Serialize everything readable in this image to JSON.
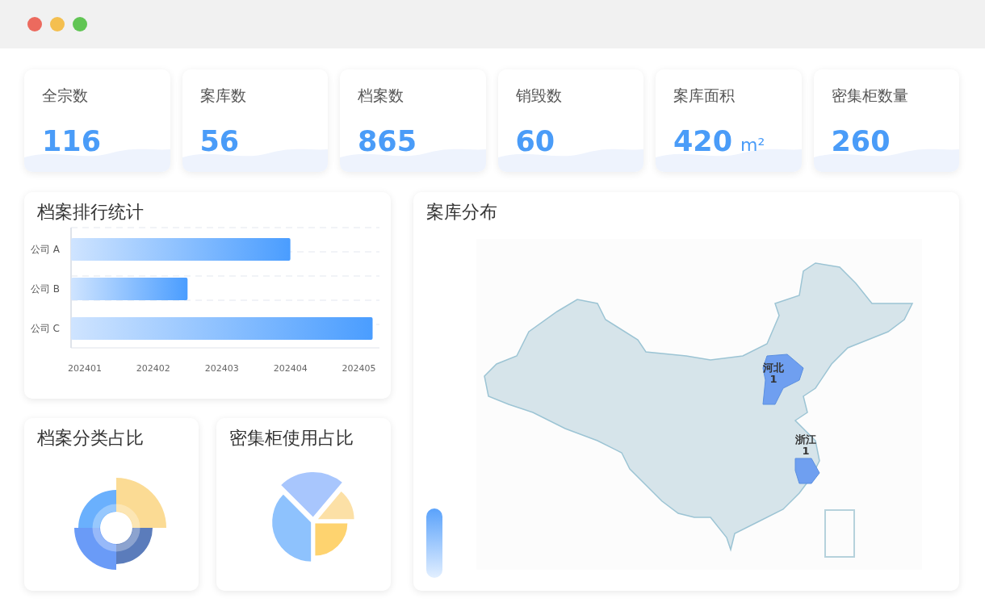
{
  "window": {
    "controls": [
      {
        "color": "#ec6a5e"
      },
      {
        "color": "#f4bf4f"
      },
      {
        "color": "#61c554"
      }
    ]
  },
  "stats": [
    {
      "label": "全宗数",
      "value": "116"
    },
    {
      "label": "案库数",
      "value": "56"
    },
    {
      "label": "档案数",
      "value": "865"
    },
    {
      "label": "销毁数",
      "value": "60"
    },
    {
      "label": "案库面积",
      "value": "420",
      "unit": "m²"
    },
    {
      "label": "密集柜数量",
      "value": "260"
    }
  ],
  "ranking": {
    "title": "档案排行统计",
    "chart_data": {
      "type": "bar",
      "orientation": "horizontal",
      "categories": [
        "公司 A",
        "公司 B",
        "公司 C"
      ],
      "series": [
        {
          "color": "#4a9dff",
          "values": [
            202404,
            202402.5,
            202405.2
          ]
        }
      ],
      "xlim": [
        202400.8,
        202405.3
      ],
      "xticks": [
        202401,
        202402,
        202403,
        202404,
        202405
      ]
    }
  },
  "category": {
    "title": "档案分类占比"
  },
  "cabinet": {
    "title": "密集柜使用占比"
  },
  "distribution": {
    "title": "案库分布",
    "regions": [
      {
        "kind": "hebei",
        "name": "河北",
        "value": "1"
      },
      {
        "kind": "zhejiang",
        "name": "浙江",
        "value": "1"
      }
    ]
  }
}
